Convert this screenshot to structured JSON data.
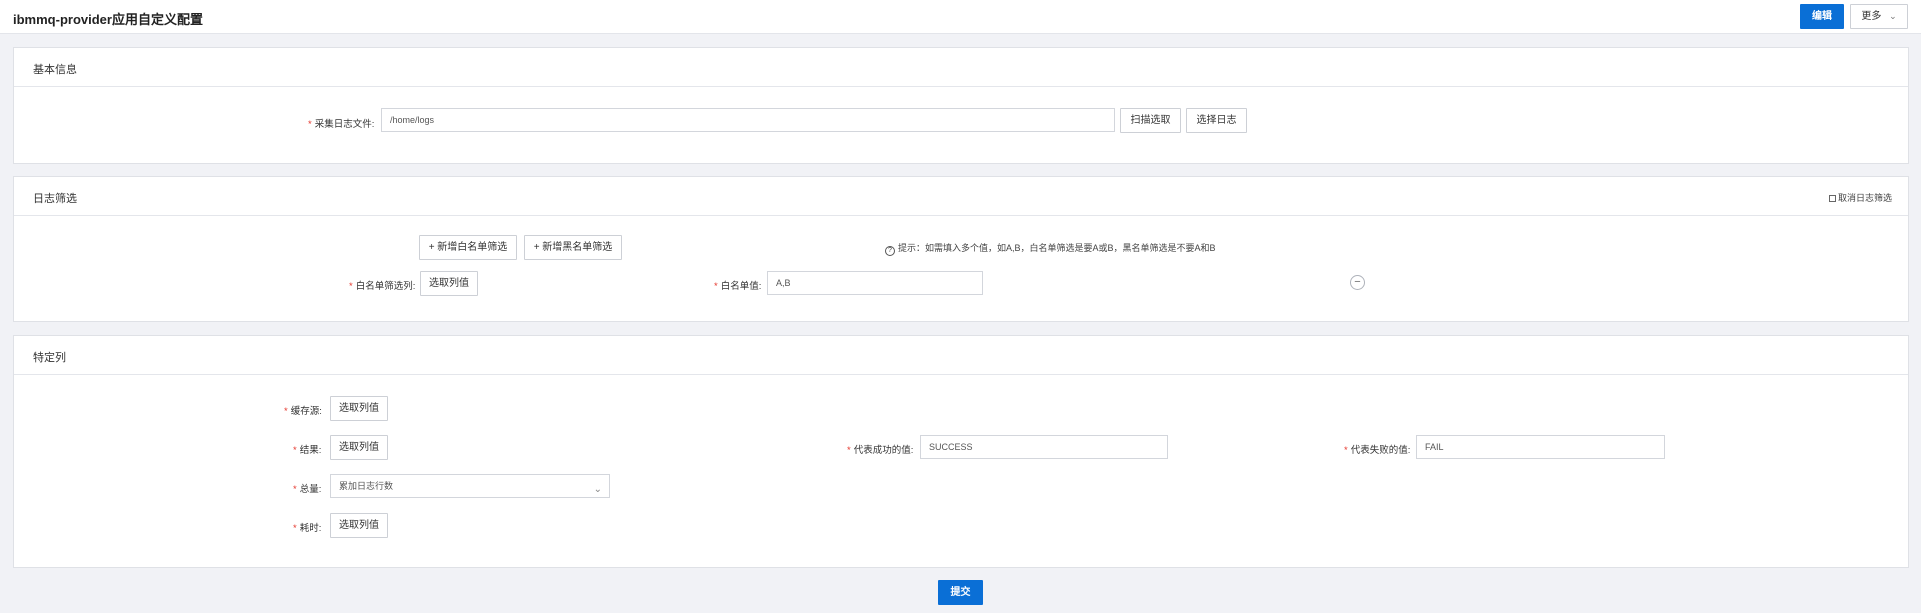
{
  "header": {
    "title": "ibmmq-provider应用自定义配置",
    "edit_label": "编辑",
    "more_label": "更多"
  },
  "basic_info": {
    "title": "基本信息",
    "log_file_label": "采集日志文件:",
    "log_file_value": "/home/logs",
    "scan_button": "扫描选取",
    "select_log_button": "选择日志"
  },
  "log_filter": {
    "title": "日志筛选",
    "cancel_filter_link": "取消日志筛选",
    "add_whitelist_button": "+ 新增白名单筛选",
    "add_blacklist_button": "+ 新增黑名单筛选",
    "hint": "提示：如需填入多个值，如A,B，白名单筛选是要A或B，黑名单筛选是不要A和B",
    "whitelist_column_label": "白名单筛选列:",
    "whitelist_column_button": "选取列值",
    "whitelist_value_label": "白名单值:",
    "whitelist_value": "A,B"
  },
  "specific_columns": {
    "title": "特定列",
    "cache_source_label": "缓存源:",
    "cache_source_button": "选取列值",
    "result_label": "结果:",
    "result_button": "选取列值",
    "success_value_label": "代表成功的值:",
    "success_value": "SUCCESS",
    "fail_value_label": "代表失败的值:",
    "fail_value": "FAIL",
    "total_label": "总量:",
    "total_value": "累加日志行数",
    "duration_label": "耗时:",
    "duration_button": "选取列值"
  },
  "submit_label": "提交"
}
